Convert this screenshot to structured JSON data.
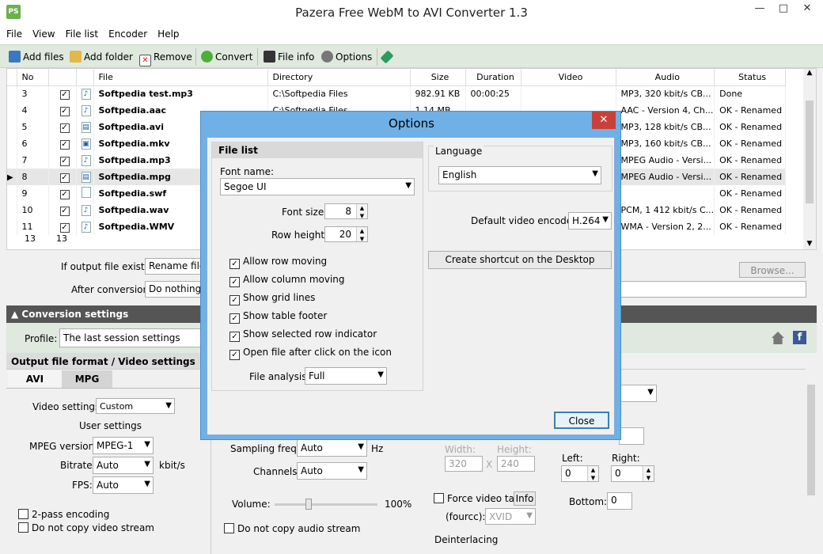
{
  "window": {
    "title": "Pazera Free WebM to AVI Converter 1.3",
    "app_icon": "PS"
  },
  "menu": [
    "File",
    "View",
    "File list",
    "Encoder",
    "Help"
  ],
  "toolbar": {
    "add_files": "Add files",
    "add_folder": "Add folder",
    "remove": "Remove",
    "convert": "Convert",
    "file_info": "File info",
    "options": "Options"
  },
  "grid": {
    "columns": [
      "No",
      "",
      "",
      "File",
      "Directory",
      "Size",
      "Duration",
      "Video",
      "Audio",
      "Status"
    ],
    "rows": [
      {
        "no": "3",
        "file": "Softpedia test.mp3",
        "dir": "C:\\Softpedia Files",
        "size": "982.91 KB",
        "dur": "00:00:25",
        "video": "",
        "audio": "MP3, 320 kbit/s CB...",
        "status": "Done"
      },
      {
        "no": "4",
        "file": "Softpedia.aac",
        "dir": "C:\\Softpedia Files",
        "size": "1.14 MB",
        "dur": "",
        "video": "",
        "audio": "AAC - Version 4, Ch...",
        "status": "OK - Renamed"
      },
      {
        "no": "5",
        "file": "Softpedia.avi",
        "dir": "",
        "size": "",
        "dur": "",
        "video": "",
        "audio": "MP3, 128 kbit/s CB...",
        "status": "OK - Renamed"
      },
      {
        "no": "6",
        "file": "Softpedia.mkv",
        "dir": "",
        "size": "",
        "dur": "",
        "video": "",
        "audio": "MP3, 160 kbit/s CB...",
        "status": "OK - Renamed"
      },
      {
        "no": "7",
        "file": "Softpedia.mp3",
        "dir": "",
        "size": "",
        "dur": "",
        "video": "",
        "audio": "MPEG Audio - Versi...",
        "status": "OK - Renamed"
      },
      {
        "no": "8",
        "file": "Softpedia.mpg",
        "dir": "",
        "size": "",
        "dur": "",
        "video": "",
        "audio": "MPEG Audio - Versi...",
        "status": "OK - Renamed"
      },
      {
        "no": "9",
        "file": "Softpedia.swf",
        "dir": "",
        "size": "",
        "dur": "",
        "video": "",
        "audio": "",
        "status": "OK - Renamed"
      },
      {
        "no": "10",
        "file": "Softpedia.wav",
        "dir": "",
        "size": "",
        "dur": "",
        "video": "",
        "audio": "PCM, 1 412 kbit/s C...",
        "status": "OK - Renamed"
      },
      {
        "no": "11",
        "file": "Softpedia.WMV",
        "dir": "",
        "size": "",
        "dur": "",
        "video": "",
        "audio": "WMA - Version 2, 2...",
        "status": "OK - Renamed"
      }
    ],
    "footer_left": "13",
    "footer_right": "13"
  },
  "output": {
    "if_exists_label": "If output file exists:",
    "if_exists_value": "Rename file",
    "after_label": "After conversion:",
    "after_value": "Do nothing",
    "browse": "Browse..."
  },
  "conversion": {
    "section_title": "Conversion settings",
    "profile_label": "Profile:",
    "profile_value": "The last session settings",
    "format_title": "Output file format / Video settings",
    "tabs": [
      "AVI",
      "MPG"
    ],
    "video_settings_label": "Video settings:",
    "video_settings_value": "Custom",
    "user_settings": "User settings",
    "mpeg_version_label": "MPEG version:",
    "mpeg_version_value": "MPEG-1",
    "bitrate_label": "Bitrate:",
    "bitrate_value": "Auto",
    "bitrate_unit": "kbit/s",
    "fps_label": "FPS:",
    "fps_value": "Auto",
    "two_pass": "2-pass encoding",
    "no_copy_video": "Do not copy video stream",
    "sampling_label": "Sampling freq.:",
    "sampling_value": "Auto",
    "sampling_unit": "Hz",
    "channels_label": "Channels:",
    "channels_value": "Auto",
    "volume_label": "Volume:",
    "volume_value": "100%",
    "no_copy_audio": "Do not copy audio stream",
    "width_label": "Width:",
    "width_value": "320",
    "height_label": "Height:",
    "height_value": "240",
    "x_sep": "X",
    "force_tag": "Force video tag",
    "info": "Info",
    "fourcc_label": "(fourcc):",
    "fourcc_value": "XVID",
    "deinterlacing": "Deinterlacing",
    "left_label": "Left:",
    "left_value": "0",
    "right_label": "Right:",
    "right_value": "0",
    "bottom_label": "Bottom:",
    "bottom_value": "0"
  },
  "options": {
    "title": "Options",
    "file_list_header": "File list",
    "font_name_label": "Font name:",
    "font_name_value": "Segoe UI",
    "font_size_label": "Font size:",
    "font_size_value": "8",
    "row_height_label": "Row height:",
    "row_height_value": "20",
    "checks": [
      "Allow row moving",
      "Allow column moving",
      "Show grid lines",
      "Show table footer",
      "Show selected row indicator",
      "Open file after click on the icon"
    ],
    "file_analysis_label": "File analysis:",
    "file_analysis_value": "Full",
    "language_label": "Language",
    "language_value": "English",
    "default_encoder_label": "Default video encoder:",
    "default_encoder_value": "H.264",
    "shortcut_button": "Create shortcut on the Desktop",
    "close_button": "Close"
  }
}
